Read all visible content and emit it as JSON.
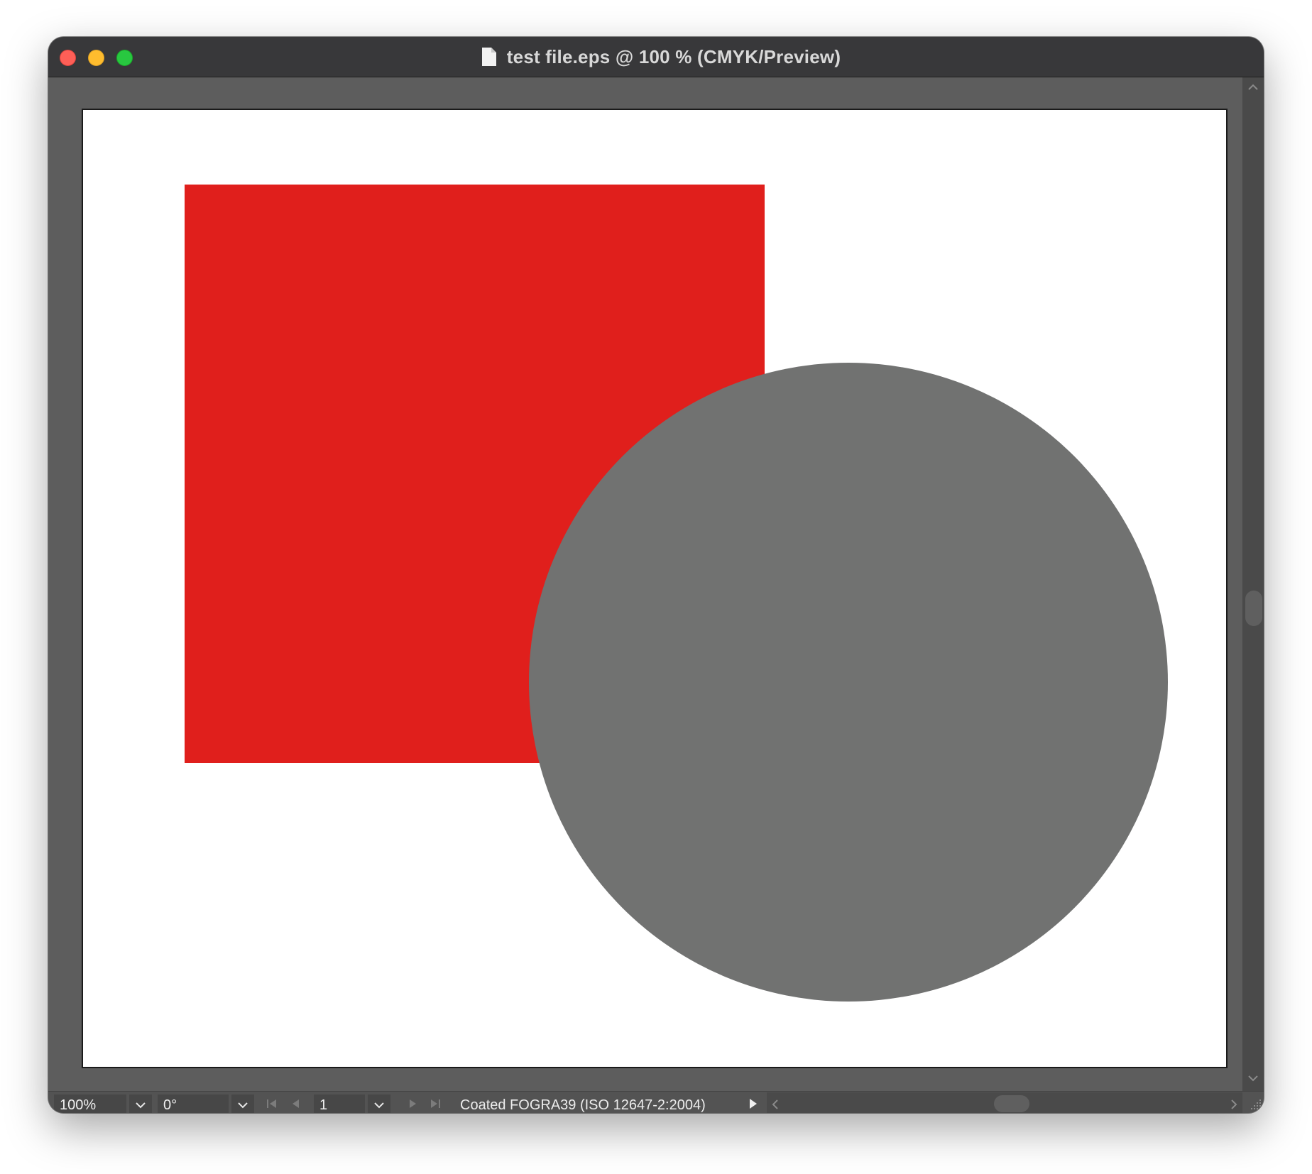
{
  "window": {
    "title": "test file.eps @ 100 % (CMYK/Preview)"
  },
  "canvas": {
    "shapes": [
      {
        "kind": "rectangle",
        "fill": "#e01f1c"
      },
      {
        "kind": "circle",
        "fill": "#717271"
      }
    ]
  },
  "statusbar": {
    "zoom": "100%",
    "rotation": "0°",
    "page": "1",
    "color_profile": "Coated FOGRA39 (ISO 12647-2:2004)"
  },
  "icons": {
    "close": "close-button",
    "minimize": "minimize-button",
    "maximize": "maximize-button",
    "document": "document-icon"
  }
}
